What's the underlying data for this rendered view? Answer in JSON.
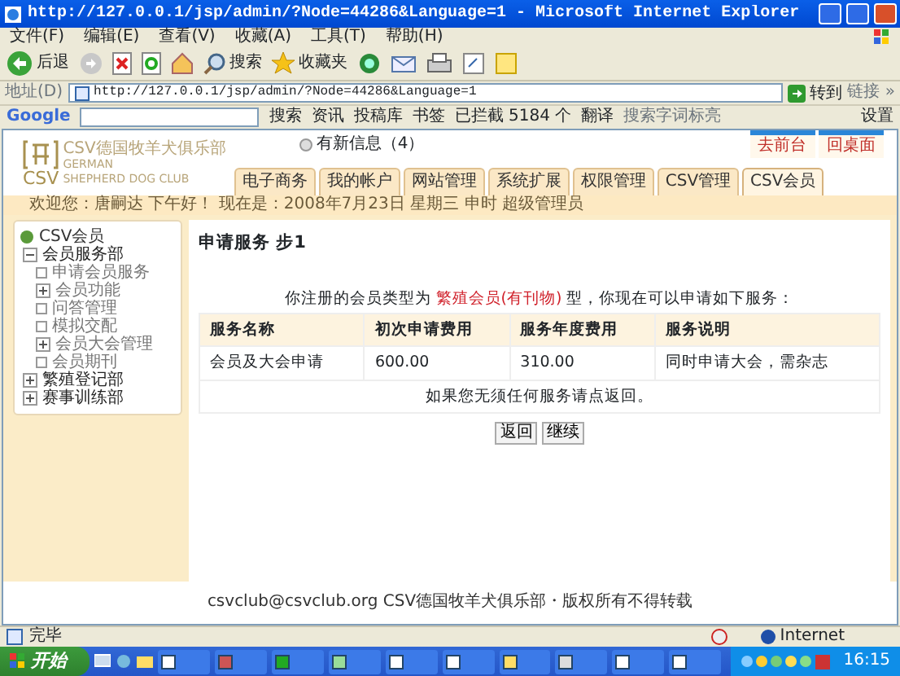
{
  "window": {
    "title": "http://127.0.0.1/jsp/admin/?Node=44286&Language=1 - Microsoft Internet Explorer"
  },
  "menu": [
    "文件(F)",
    "编辑(E)",
    "查看(V)",
    "收藏(A)",
    "工具(T)",
    "帮助(H)"
  ],
  "toolbar": {
    "back": "后退",
    "search": "搜索",
    "favorites": "收藏夹"
  },
  "address": {
    "label": "地址(D)",
    "value": "http://127.0.0.1/jsp/admin/?Node=44286&Language=1",
    "go": "转到",
    "links": "链接 »"
  },
  "google_bar": {
    "logo": "Google",
    "search": "搜索",
    "news": "资讯",
    "pagerank": "投稿库",
    "bookmarks": "书签",
    "blocked": "已拦截 5184 个",
    "translate": "翻译",
    "spell": "搜索字词标亮",
    "settings": "设置"
  },
  "site": {
    "logo_mark": "CSV",
    "club_name": "CSV德国牧羊犬俱乐部",
    "club_en_1": "GERMAN",
    "club_en_2": "SHEPHERD DOG CLUB",
    "messages": "有新信息（4）",
    "links": [
      "去前台",
      "回桌面"
    ],
    "tabs": [
      {
        "label": "电子商务",
        "selected": false
      },
      {
        "label": "我的帐户",
        "selected": false
      },
      {
        "label": "网站管理",
        "selected": false
      },
      {
        "label": "系统扩展",
        "selected": false
      },
      {
        "label": "权限管理",
        "selected": false
      },
      {
        "label": "CSV管理",
        "selected": false
      },
      {
        "label": "CSV会员",
        "selected": true
      }
    ],
    "welcome": "欢迎您：唐嗣达 下午好！ 现在是：2008年7月23日 星期三 申时 超级管理员"
  },
  "sidebar": {
    "root": "CSV会员",
    "items": [
      {
        "label": "会员服务部",
        "expanded": true,
        "children": [
          {
            "label": "申请会员服务"
          },
          {
            "label": "会员功能",
            "expanded": false
          },
          {
            "label": "问答管理"
          },
          {
            "label": "模拟交配"
          },
          {
            "label": "会员大会管理",
            "expanded": false
          },
          {
            "label": "会员期刊"
          }
        ]
      },
      {
        "label": "繁殖登记部",
        "expanded": false
      },
      {
        "label": "赛事训练部",
        "expanded": false
      }
    ]
  },
  "main": {
    "heading": "申请服务 步1",
    "notice": {
      "before": "你注册的会员类型为 ",
      "highlight": "繁殖会员(有刊物)",
      "after": " 型，你现在可以申请如下服务："
    },
    "table": {
      "columns": [
        "服务名称",
        "初次申请费用",
        "服务年度费用",
        "服务说明"
      ],
      "rows": [
        [
          "会员及大会申请",
          "600.00",
          "310.00",
          "同时申请大会，需杂志"
        ]
      ],
      "note": "如果您无须任何服务请点返回。"
    },
    "buttons": [
      "返回",
      "继续"
    ]
  },
  "footer": "csvclub@csvclub.org CSV德国牧羊犬俱乐部・版权所有不得转载",
  "status_bar": {
    "text": "完毕",
    "zone": "Internet"
  },
  "taskbar": {
    "start": "开始",
    "clock": "16:15"
  }
}
